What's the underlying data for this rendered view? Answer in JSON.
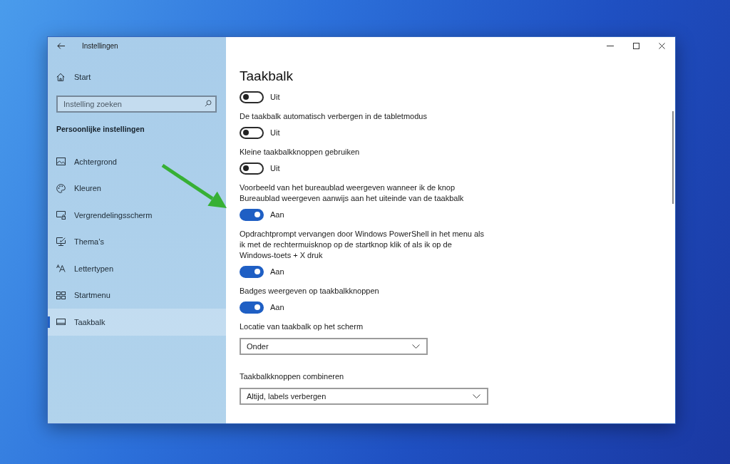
{
  "window": {
    "title": "Instellingen"
  },
  "sidebar": {
    "home": "Start",
    "search": {
      "placeholder": "Instelling zoeken"
    },
    "section_title": "Persoonlijke instellingen",
    "items": [
      {
        "label": "Achtergrond",
        "selected": false
      },
      {
        "label": "Kleuren",
        "selected": false
      },
      {
        "label": "Vergrendelingsscherm",
        "selected": false
      },
      {
        "label": "Thema’s",
        "selected": false
      },
      {
        "label": "Lettertypen",
        "selected": false
      },
      {
        "label": "Startmenu",
        "selected": false
      },
      {
        "label": "Taakbalk",
        "selected": true
      }
    ]
  },
  "page": {
    "title": "Taakbalk",
    "settings": [
      {
        "kind": "toggle",
        "on": false,
        "state_text": "Uit"
      },
      {
        "kind": "toggle",
        "label": "De taakbalk automatisch verbergen in de tabletmodus",
        "on": false,
        "state_text": "Uit"
      },
      {
        "kind": "toggle",
        "label": "Kleine taakbalkknoppen gebruiken",
        "on": false,
        "state_text": "Uit"
      },
      {
        "kind": "toggle",
        "label": "Voorbeeld van het bureaublad weergeven wanneer ik de knop Bureaublad weergeven aanwijs aan het uiteinde van de taakbalk",
        "on": true,
        "state_text": "Aan"
      },
      {
        "kind": "toggle",
        "label": "Opdrachtprompt vervangen door Windows PowerShell in het menu als ik met de rechtermuisknop op de startknop klik of als ik op de Windows-toets + X druk",
        "on": true,
        "state_text": "Aan"
      },
      {
        "kind": "toggle",
        "label": "Badges weergeven op taakbalkknoppen",
        "on": true,
        "state_text": "Aan"
      },
      {
        "kind": "dropdown",
        "label": "Locatie van taakbalk op het scherm",
        "value": "Onder"
      },
      {
        "kind": "dropdown",
        "label": "Taakbalkknoppen combineren",
        "value": "Altijd, labels verbergen"
      }
    ]
  }
}
